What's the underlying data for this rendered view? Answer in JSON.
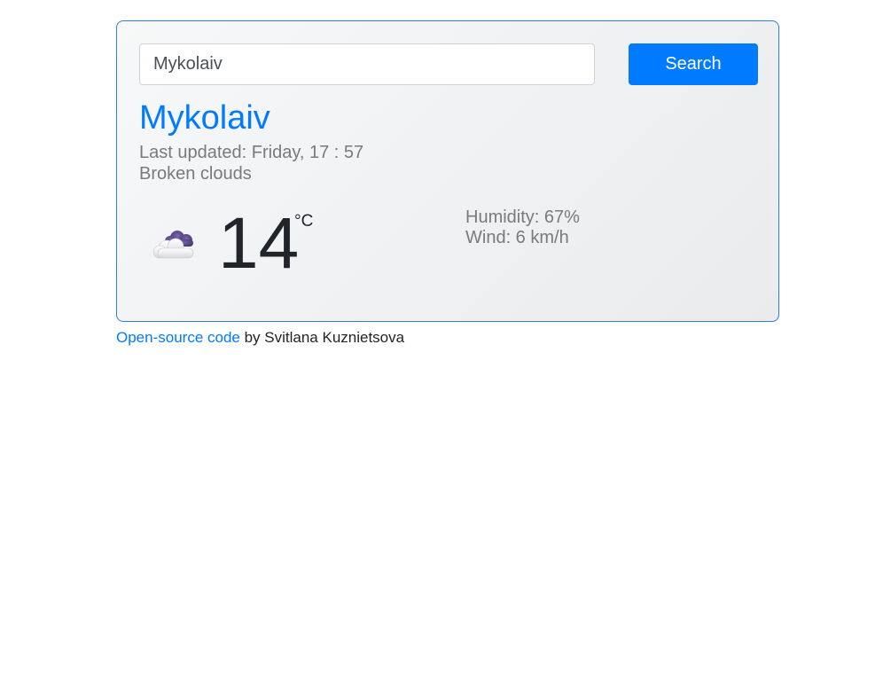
{
  "search": {
    "value": "Mykolaiv",
    "button_label": "Search"
  },
  "weather": {
    "city": "Mykolaiv",
    "last_updated": "Last updated: Friday, 17 : 57",
    "description": "Broken clouds",
    "icon": "broken-clouds-icon",
    "temperature": "14",
    "unit": "°C",
    "humidity": "Humidity: 67%",
    "wind": "Wind: 6 km/h"
  },
  "footer": {
    "link_text": "Open-source code",
    "author_text": " by Svitlana Kuznietsova"
  },
  "colors": {
    "accent": "#007bff",
    "card_border": "#2b7de9",
    "muted_text": "#7a7a7a",
    "cloud_dark": "#5a4a8c"
  }
}
